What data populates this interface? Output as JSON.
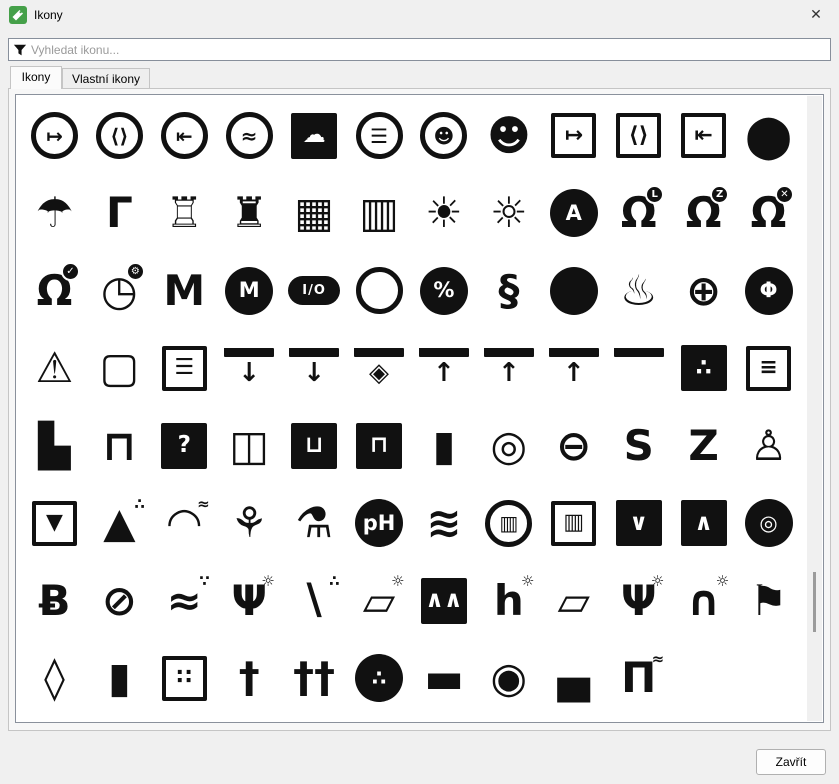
{
  "window": {
    "title": "Ikony",
    "close_glyph": "✕"
  },
  "search": {
    "placeholder": "Vyhledat ikonu...",
    "value": "",
    "filter_icon": "funnel-icon"
  },
  "tabs": [
    {
      "label": "Ikony",
      "active": true
    },
    {
      "label": "Vlastní ikony",
      "active": false
    }
  ],
  "footer": {
    "close_button": "Zavřít"
  },
  "accent_colors": {
    "app_icon_green": "#45a049",
    "icon_black": "#111111",
    "window_bg": "#f0f0f0"
  },
  "icon_grid": {
    "rows": [
      [
        {
          "n": "shutter-open-circle",
          "g": "↦",
          "f": "circle"
        },
        {
          "n": "shutter-partial-circle",
          "g": "⟨⟩",
          "f": "circle"
        },
        {
          "n": "shutter-closed-circle",
          "g": "⇤",
          "f": "circle"
        },
        {
          "n": "awning-waves-circle",
          "g": "≈",
          "f": "circle"
        },
        {
          "n": "projector-screen-chat",
          "g": "☁",
          "f": "sqfill"
        },
        {
          "n": "blinds-round",
          "g": "☰",
          "f": "circle"
        },
        {
          "n": "user-avatar-circle",
          "g": "☻",
          "f": "circle"
        },
        {
          "n": "user-avatar",
          "g": "☻"
        },
        {
          "n": "shutter-open-square",
          "g": "↦",
          "f": "square"
        },
        {
          "n": "shutter-partial-square",
          "g": "⟨⟩",
          "f": "square"
        },
        {
          "n": "shutter-closed-square",
          "g": "⇤",
          "f": "square"
        },
        {
          "n": "speech-bubble",
          "g": "⬤"
        }
      ],
      [
        {
          "n": "umbrella-lamp",
          "g": "☂"
        },
        {
          "n": "desk-lamp",
          "g": "Γ"
        },
        {
          "n": "balcony-curtain",
          "g": "♖"
        },
        {
          "n": "balcony-railing",
          "g": "♜"
        },
        {
          "n": "balcony-solid",
          "g": "▦"
        },
        {
          "n": "balcony-vents",
          "g": "▥"
        },
        {
          "n": "sun-bright",
          "g": "☀"
        },
        {
          "n": "sun-dim",
          "g": "☼"
        },
        {
          "n": "auto-mode-disc",
          "g": "A",
          "f": "disc"
        },
        {
          "n": "bell-reminder",
          "g": "Ω",
          "b": "L",
          "bd": 1
        },
        {
          "n": "bell-snooze",
          "g": "Ω",
          "b": "Z",
          "bd": 1
        },
        {
          "n": "bell-dismiss",
          "g": "Ω",
          "b": "✕",
          "bd": 1
        }
      ],
      [
        {
          "n": "bell-confirmed",
          "g": "Ω",
          "b": "✓",
          "bd": 1
        },
        {
          "n": "alarm-clock-settings",
          "g": "◷",
          "b": "⚙",
          "bd": 1
        },
        {
          "n": "letter-m",
          "g": "M"
        },
        {
          "n": "letter-m-disc",
          "g": "M",
          "f": "disc"
        },
        {
          "n": "io-toggle",
          "g": "I/O",
          "f": "pill"
        },
        {
          "n": "ring-outline",
          "g": "",
          "f": "circle"
        },
        {
          "n": "humidity-drop",
          "g": "%",
          "f": "disc"
        },
        {
          "n": "energy-saving-bulb",
          "g": "§"
        },
        {
          "n": "filled-circle",
          "g": "",
          "f": "disc"
        },
        {
          "n": "flame",
          "g": "♨"
        },
        {
          "n": "globe",
          "g": "⊕"
        },
        {
          "n": "power-button",
          "g": "Φ",
          "f": "disc"
        }
      ],
      [
        {
          "n": "warning-triangle",
          "g": "⚠"
        },
        {
          "n": "roller-door",
          "g": "▢"
        },
        {
          "n": "roller-shutter-stack",
          "g": "☰",
          "f": "square"
        },
        {
          "n": "awning-extend",
          "g": "↓",
          "f": "awning"
        },
        {
          "n": "awning-extend-small",
          "g": "↓",
          "f": "awning"
        },
        {
          "n": "awning-diamond",
          "g": "◈",
          "f": "awning"
        },
        {
          "n": "awning-retract",
          "g": "↑",
          "f": "awning"
        },
        {
          "n": "awning-retract-alt",
          "g": "↑",
          "f": "awning"
        },
        {
          "n": "awning-retract-small",
          "g": "↑",
          "f": "awning"
        },
        {
          "n": "awning-frame",
          "g": "",
          "f": "awning"
        },
        {
          "n": "socket-swiss",
          "g": "∴",
          "f": "sqfill"
        },
        {
          "n": "garage-door",
          "g": "≡",
          "f": "square"
        }
      ],
      [
        {
          "n": "boots",
          "g": "▙"
        },
        {
          "n": "door-frame",
          "g": "⊓"
        },
        {
          "n": "door-unknown",
          "g": "?",
          "f": "sqfill"
        },
        {
          "n": "door-open",
          "g": "◫"
        },
        {
          "n": "door-unlocked",
          "g": "⊔",
          "f": "sqfill"
        },
        {
          "n": "door-locked",
          "g": "⊓",
          "f": "sqfill"
        },
        {
          "n": "spot-light-cylinder",
          "g": "▮"
        },
        {
          "n": "spot-light-ring",
          "g": "◎"
        },
        {
          "n": "spot-light-flat",
          "g": "⊖"
        },
        {
          "n": "film-strip-s",
          "g": "S"
        },
        {
          "n": "film-strip-z",
          "g": "Z"
        },
        {
          "n": "eiffel-tower",
          "g": "♙"
        }
      ],
      [
        {
          "n": "printer-3d",
          "g": "▼",
          "f": "square"
        },
        {
          "n": "sand-pile",
          "g": "▲",
          "b": "∴"
        },
        {
          "n": "fountain-light",
          "g": "◠",
          "b": "≈"
        },
        {
          "n": "irrigation-plants",
          "g": "⚘"
        },
        {
          "n": "chemistry-flask",
          "g": "⚗"
        },
        {
          "n": "ph-drop",
          "g": "pH",
          "f": "disc"
        },
        {
          "n": "swimmer",
          "g": "≋"
        },
        {
          "n": "vent-round",
          "g": "▥",
          "f": "circle"
        },
        {
          "n": "vent-rect",
          "g": "▥",
          "f": "square"
        },
        {
          "n": "intake-down",
          "g": "∨",
          "f": "sqfill"
        },
        {
          "n": "intake-up",
          "g": "∧",
          "f": "sqfill"
        },
        {
          "n": "speaker-disc",
          "g": "◎",
          "f": "disc"
        }
      ],
      [
        {
          "n": "bluetooth",
          "g": "Ƀ"
        },
        {
          "n": "vacuum-disabled",
          "g": "⊘"
        },
        {
          "n": "waves-drops",
          "g": "≈",
          "b": "∵"
        },
        {
          "n": "dining-sun",
          "g": "Ψ",
          "b": "☼"
        },
        {
          "n": "sweeping-broom",
          "g": "∖",
          "b": "∴"
        },
        {
          "n": "sun-lounger",
          "g": "▱",
          "b": "☼"
        },
        {
          "n": "picture-frame",
          "g": "∧∧",
          "f": "sqfill"
        },
        {
          "n": "lounge-sofa-sun",
          "g": "h",
          "b": "☼"
        },
        {
          "n": "chaise-longue",
          "g": "▱"
        },
        {
          "n": "terrace-dining-sun",
          "g": "Ψ",
          "b": "☼"
        },
        {
          "n": "outdoor-shower-sun",
          "g": "∩",
          "b": "☼"
        },
        {
          "n": "golf-flag",
          "g": "⚑"
        }
      ],
      [
        {
          "n": "updown-chevrons",
          "g": "◊"
        },
        {
          "n": "usb-flash-drive",
          "g": "▮"
        },
        {
          "n": "usb-plug",
          "g": "∷",
          "f": "square"
        },
        {
          "n": "audio-jack",
          "g": "†"
        },
        {
          "n": "audio-jack-double",
          "g": "††"
        },
        {
          "n": "socket-round",
          "g": "∴",
          "f": "disc"
        },
        {
          "n": "hdmi-plug",
          "g": "▬"
        },
        {
          "n": "robot-vacuum-dock",
          "g": "◉"
        },
        {
          "n": "robot-mower",
          "g": "▄"
        },
        {
          "n": "pool-ladder",
          "g": "Π",
          "b": "≈"
        }
      ]
    ]
  }
}
